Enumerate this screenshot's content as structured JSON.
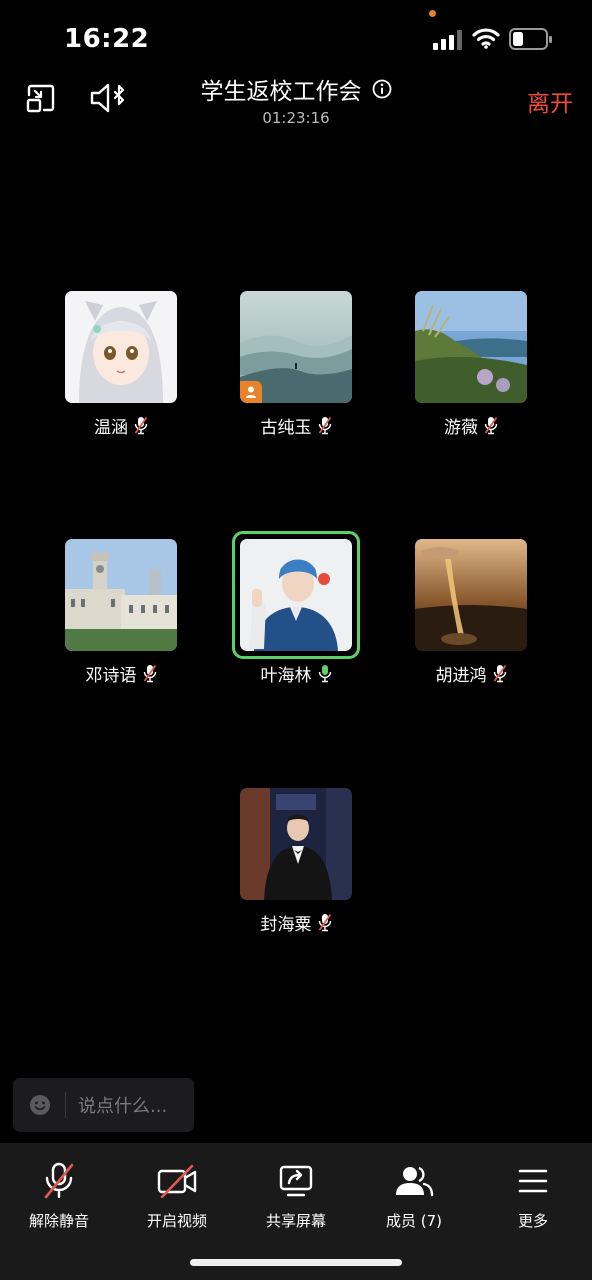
{
  "status_bar": {
    "time": "16:22"
  },
  "header": {
    "title": "学生返校工作会",
    "timer": "01:23:16",
    "leave_label": "离开"
  },
  "participants": [
    {
      "name": "温涵",
      "mic": "mic-muted-icon",
      "active": false,
      "host": false
    },
    {
      "name": "古纯玉",
      "mic": "mic-muted-icon",
      "active": false,
      "host": true
    },
    {
      "name": "游薇",
      "mic": "mic-muted-icon",
      "active": false,
      "host": false
    },
    {
      "name": "邓诗语",
      "mic": "mic-muted-icon",
      "active": false,
      "host": false
    },
    {
      "name": "叶海林",
      "mic": "mic-on-icon",
      "active": true,
      "host": false
    },
    {
      "name": "胡进鸿",
      "mic": "mic-muted-icon",
      "active": false,
      "host": false
    },
    {
      "name": "封海粟",
      "mic": "mic-muted-icon",
      "active": false,
      "host": false
    }
  ],
  "chat": {
    "placeholder": "说点什么..."
  },
  "toolbar": {
    "unmute": "解除静音",
    "video": "开启视频",
    "share": "共享屏幕",
    "members": "成员 (7)",
    "more": "更多"
  },
  "colors": {
    "leave": "#ef4a3a",
    "active_ring": "#5fd065",
    "host_badge": "#e8832a",
    "muted_slash": "#e05a4f"
  }
}
